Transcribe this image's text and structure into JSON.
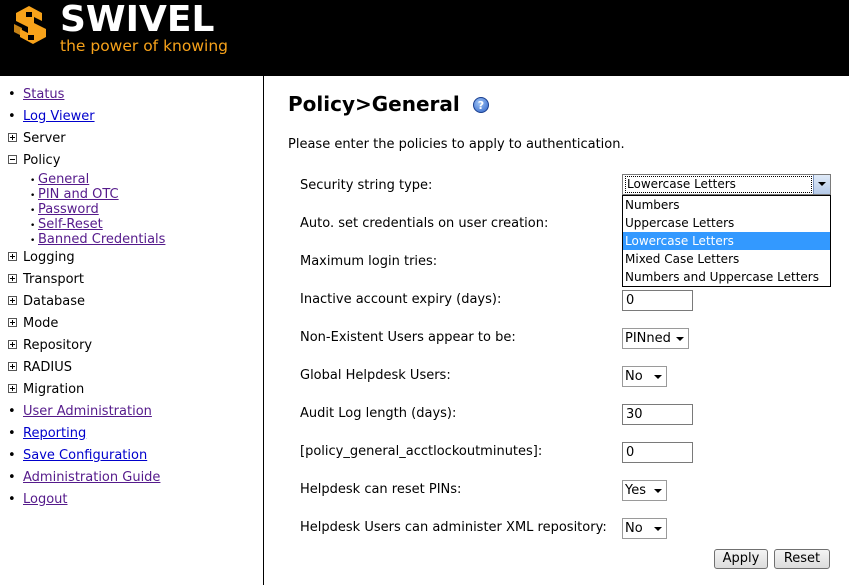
{
  "brand": {
    "name": "SWIVEL",
    "tagline": "the power of knowing"
  },
  "sidebar": {
    "items": [
      {
        "label": "Status",
        "kind": "link"
      },
      {
        "label": "Log Viewer",
        "kind": "link"
      },
      {
        "label": "Server",
        "kind": "group"
      },
      {
        "label": "Policy",
        "kind": "group-open"
      },
      {
        "label": "Logging",
        "kind": "group"
      },
      {
        "label": "Transport",
        "kind": "group"
      },
      {
        "label": "Database",
        "kind": "group"
      },
      {
        "label": "Mode",
        "kind": "group"
      },
      {
        "label": "Repository",
        "kind": "group"
      },
      {
        "label": "RADIUS",
        "kind": "group"
      },
      {
        "label": "Migration",
        "kind": "group"
      },
      {
        "label": "User Administration",
        "kind": "link"
      },
      {
        "label": "Reporting",
        "kind": "link"
      },
      {
        "label": "Save Configuration",
        "kind": "link"
      },
      {
        "label": "Administration Guide",
        "kind": "link"
      },
      {
        "label": "Logout",
        "kind": "link"
      }
    ],
    "policy_sub": [
      "General",
      "PIN and OTC",
      "Password",
      "Self-Reset",
      "Banned Credentials"
    ]
  },
  "main": {
    "title": "Policy>General",
    "intro": "Please enter the policies to apply to authentication.",
    "fields": [
      {
        "label": "Security string type:",
        "type": "dropdown-open",
        "value": "Lowercase Letters"
      },
      {
        "label": "Auto. set credentials on user creation:",
        "type": "hidden"
      },
      {
        "label": "Maximum login tries:",
        "type": "hidden"
      },
      {
        "label": "Inactive account expiry (days):",
        "type": "text",
        "value": "0"
      },
      {
        "label": "Non-Existent Users appear to be:",
        "type": "select",
        "value": "PINned"
      },
      {
        "label": "Global Helpdesk Users:",
        "type": "select",
        "value": "No"
      },
      {
        "label": "Audit Log length (days):",
        "type": "text",
        "value": "30"
      },
      {
        "label": "[policy_general_acctlockoutminutes]:",
        "type": "text",
        "value": "0"
      },
      {
        "label": "Helpdesk can reset PINs:",
        "type": "select",
        "value": "Yes"
      },
      {
        "label": "Helpdesk Users can administer XML repository:",
        "type": "select",
        "value": "No"
      }
    ],
    "dropdown_options": [
      "Numbers",
      "Uppercase Letters",
      "Lowercase Letters",
      "Mixed Case Letters",
      "Numbers and Uppercase Letters"
    ],
    "dropdown_selected_index": 2,
    "apply_label": "Apply",
    "reset_label": "Reset"
  },
  "colors": {
    "header_bg": "#000000",
    "brand_orange": "#f7a21a",
    "visited_link": "#551a8b",
    "link": "#0000cc",
    "highlight": "#3399ff"
  }
}
